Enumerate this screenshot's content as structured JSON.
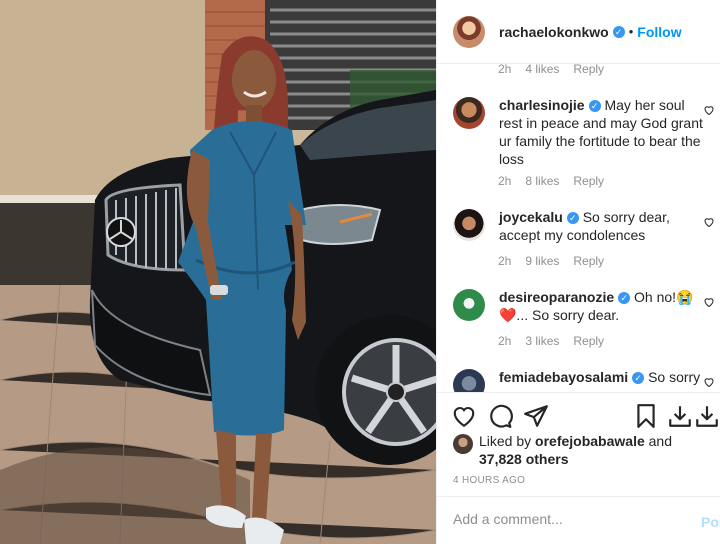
{
  "post": {
    "owner": "rachaelokonkwo",
    "follow_label": "Follow",
    "dot": "•"
  },
  "comments": [
    {
      "username": "",
      "text": "",
      "time": "2h",
      "likes": "4 likes",
      "reply": "Reply"
    },
    {
      "username": "charlesinojie",
      "text": "May her soul rest in peace and may God grant ur family the fortitude to bear the loss",
      "time": "2h",
      "likes": "8 likes",
      "reply": "Reply"
    },
    {
      "username": "joycekalu",
      "text": "So sorry dear, accept my condolences",
      "time": "2h",
      "likes": "9 likes",
      "reply": "Reply"
    },
    {
      "username": "desireoparanozie",
      "text": "Oh no!😭",
      "text2": "❤️... So sorry dear.",
      "time": "2h",
      "likes": "3 likes",
      "reply": "Reply"
    },
    {
      "username": "femiadebayosalami",
      "text": "So sorry",
      "time": "",
      "likes": "",
      "reply": ""
    }
  ],
  "likes": {
    "prefix": "Liked by",
    "user": "orefejobabawale",
    "and": "and",
    "count": "37,828 others"
  },
  "timestamp": "4 HOURS AGO",
  "add_comment": {
    "placeholder": "Add a comment...",
    "post_label": "Post"
  },
  "icons": {
    "verified": "✓",
    "like": "heart-icon",
    "comment": "comment-icon",
    "share": "share-icon",
    "save": "bookmark-icon",
    "download": "download-icon"
  },
  "colors": {
    "link": "#0095f6",
    "verified": "#3897f0",
    "muted": "#8e8e8e",
    "post_disabled": "#b2dffc"
  }
}
